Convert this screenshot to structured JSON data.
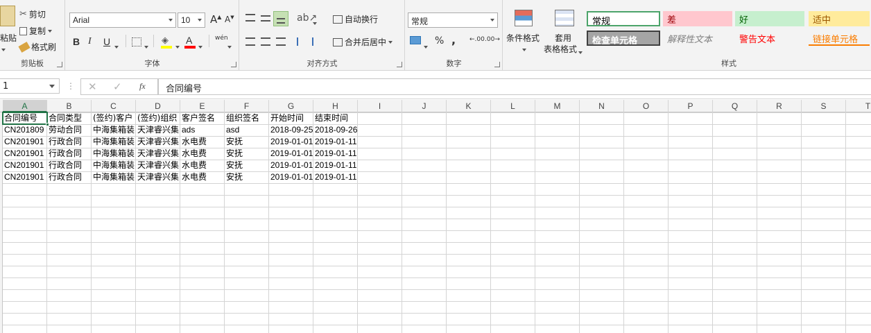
{
  "clipboard": {
    "paste_label": "粘贴",
    "cut_label": "剪切",
    "copy_label": "复制",
    "format_painter_label": "格式刷",
    "group_label": "剪贴板"
  },
  "font": {
    "name": "Arial",
    "size": "10",
    "bold": "B",
    "italic": "I",
    "underline": "U",
    "increase": "A",
    "decrease": "A",
    "fill_color": "#ffff00",
    "font_color": "#ff0000",
    "phonetic": "wén",
    "group_label": "字体"
  },
  "alignment": {
    "wrap_text_label": "自动换行",
    "merge_center_label": "合并后居中",
    "group_label": "对齐方式"
  },
  "number": {
    "format": "常规",
    "percent": "%",
    "comma": ",",
    "inc_decimal": ".00",
    "dec_decimal": ".00",
    "group_label": "数字"
  },
  "styles": {
    "conditional_label": "条件格式",
    "table_label_1": "套用",
    "table_label_2": "表格格式",
    "gallery": [
      {
        "text": "常规",
        "bg": "#ffffff",
        "color": "#000000",
        "border": "#4ca46a"
      },
      {
        "text": "差",
        "bg": "#ffc7ce",
        "color": "#9c0006"
      },
      {
        "text": "好",
        "bg": "#c6efce",
        "color": "#006100"
      },
      {
        "text": "适中",
        "bg": "#ffeb9c",
        "color": "#9c5700"
      },
      {
        "text": "检查单元格",
        "bg": "#a5a5a5",
        "color": "#ffffff",
        "border": "#3f3f3f"
      },
      {
        "text": "解释性文本",
        "bg": "transparent",
        "color": "#7f7f7f"
      },
      {
        "text": "警告文本",
        "bg": "transparent",
        "color": "#ff0000"
      },
      {
        "text": "链接单元格",
        "bg": "transparent",
        "color": "#fa7d00"
      }
    ],
    "group_label": "样式"
  },
  "formula_bar": {
    "name_box": "1",
    "content": "合同编号",
    "fx": "fx"
  },
  "columns": [
    "A",
    "B",
    "C",
    "D",
    "E",
    "F",
    "G",
    "H",
    "I",
    "J",
    "K",
    "L",
    "M",
    "N",
    "O",
    "P",
    "Q",
    "R",
    "S",
    "T"
  ],
  "rows": [
    [
      "合同编号",
      "合同类型",
      "(签约)客户",
      "(签约)组织",
      "客户签名",
      "组织签名",
      "开始时间",
      "结束时间"
    ],
    [
      "CN201809",
      "劳动合同",
      "中海集箱装",
      "天津睿兴集",
      "ads",
      "asd",
      "2018-09-25",
      "2018-09-26"
    ],
    [
      "CN201901",
      "行政合同",
      "中海集箱装",
      "天津睿兴集",
      "水电费",
      "安抚",
      "2019-01-01",
      "2019-01-11"
    ],
    [
      "CN201901",
      "行政合同",
      "中海集箱装",
      "天津睿兴集",
      "水电费",
      "安抚",
      "2019-01-01",
      "2019-01-11"
    ],
    [
      "CN201901",
      "行政合同",
      "中海集箱装",
      "天津睿兴集",
      "水电费",
      "安抚",
      "2019-01-01",
      "2019-01-11"
    ],
    [
      "CN201901",
      "行政合同",
      "中海集箱装",
      "天津睿兴集",
      "水电费",
      "安抚",
      "2019-01-01",
      "2019-01-11"
    ]
  ],
  "accent_color": "#217346"
}
